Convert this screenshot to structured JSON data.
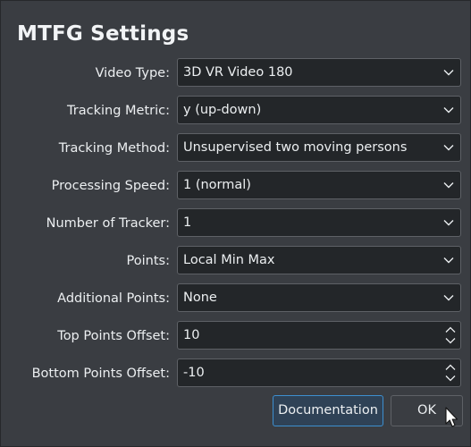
{
  "window": {
    "title": "MTFG Settings"
  },
  "rows": [
    {
      "label": "Video Type:",
      "value": "3D VR Video 180",
      "kind": "select"
    },
    {
      "label": "Tracking Metric:",
      "value": "y (up-down)",
      "kind": "select"
    },
    {
      "label": "Tracking Method:",
      "value": "Unsupervised two moving persons",
      "kind": "select"
    },
    {
      "label": "Processing Speed:",
      "value": "1 (normal)",
      "kind": "select"
    },
    {
      "label": "Number of Tracker:",
      "value": "1",
      "kind": "select"
    },
    {
      "label": "Points:",
      "value": "Local Min Max",
      "kind": "select"
    },
    {
      "label": "Additional Points:",
      "value": "None",
      "kind": "select"
    },
    {
      "label": "Top Points Offset:",
      "value": "10",
      "kind": "spinbox"
    },
    {
      "label": "Bottom Points Offset:",
      "value": "-10",
      "kind": "spinbox"
    }
  ],
  "buttons": {
    "documentation": "Documentation",
    "ok": "OK"
  },
  "icons": {
    "dropdown": "chevron-down-icon",
    "spin_up": "chevron-up-icon",
    "spin_down": "chevron-down-icon",
    "cursor": "mouse-pointer-icon"
  },
  "colors": {
    "background": "#3a3d42",
    "field": "#232629",
    "accent": "#3d8fcf",
    "text": "#eceff1"
  }
}
